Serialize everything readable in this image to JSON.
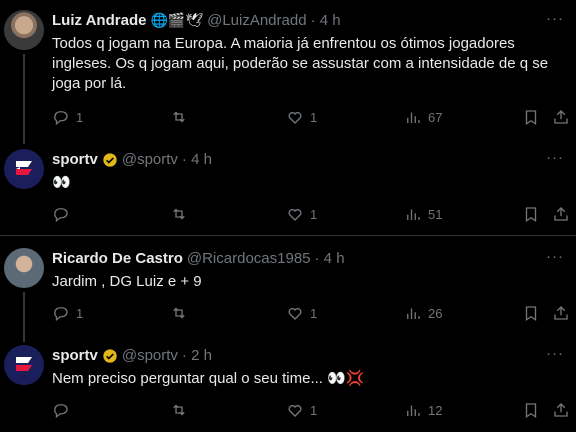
{
  "tweets": [
    {
      "name": "Luiz Andrade",
      "badges": "🌐🎬🕊",
      "handle": "@LuizAndradd",
      "time": "· 4 h",
      "text": "Todos q jogam na Europa. A maioria já enfrentou os ótimos jogadores ingleses. Os q jogam aqui, poderão se assustar com a intensidade de q se joga por lá.",
      "replies": "1",
      "reposts": "",
      "likes": "1",
      "views": "67"
    },
    {
      "name": "sportv",
      "handle": "@sportv",
      "time": "· 4 h",
      "text": "👀",
      "replies": "",
      "reposts": "",
      "likes": "1",
      "views": "51"
    },
    {
      "name": "Ricardo De Castro",
      "handle": "@Ricardocas1985",
      "time": "· 4 h",
      "text": "Jardim , DG Luiz e + 9",
      "replies": "1",
      "reposts": "",
      "likes": "1",
      "views": "26"
    },
    {
      "name": "sportv",
      "handle": "@sportv",
      "time": "· 2 h",
      "text": "Nem preciso perguntar qual o seu time... 👀💢",
      "replies": "",
      "reposts": "",
      "likes": "1",
      "views": "12"
    }
  ],
  "more_label": "···",
  "colors": {
    "background": "#000000",
    "text": "#e7e9ea",
    "muted": "#71767b",
    "verified_gold": "#e2b719",
    "divider": "#2f3336"
  }
}
